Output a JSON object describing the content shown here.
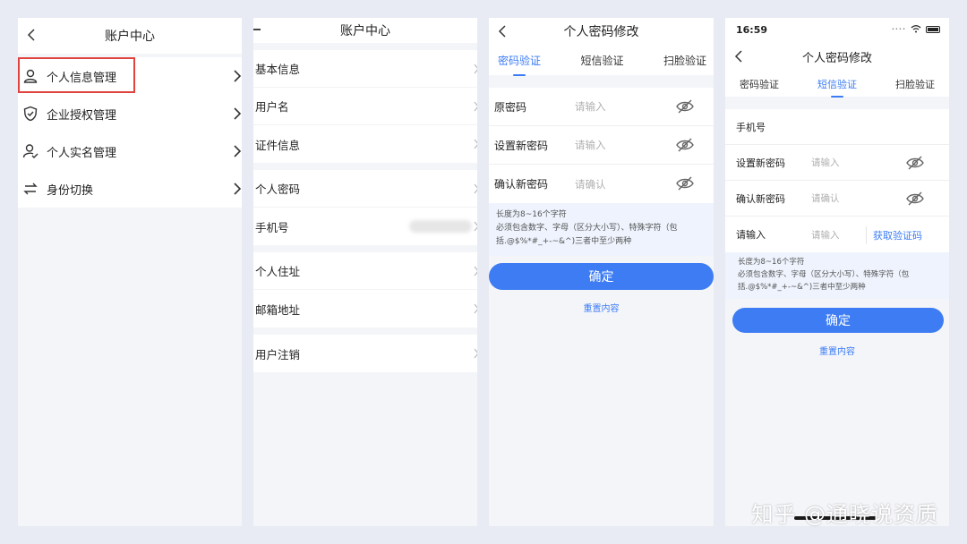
{
  "screen1": {
    "title": "账户中心",
    "items": [
      {
        "label": "个人信息管理",
        "icon": "person-icon"
      },
      {
        "label": "企业授权管理",
        "icon": "shield-icon"
      },
      {
        "label": "个人实名管理",
        "icon": "person-check-icon"
      },
      {
        "label": "身份切换",
        "icon": "switch-icon"
      }
    ]
  },
  "screen2": {
    "title": "账户中心",
    "groups": [
      [
        "基本信息",
        "用户名",
        "证件信息"
      ],
      [
        "个人密码",
        "手机号"
      ],
      [
        "个人住址",
        "邮箱地址"
      ],
      [
        "用户注销"
      ]
    ]
  },
  "screen3": {
    "title": "个人密码修改",
    "tabs": [
      "密码验证",
      "短信验证",
      "扫脸验证"
    ],
    "active_tab": 0,
    "fields": [
      {
        "label": "原密码",
        "placeholder": "请输入"
      },
      {
        "label": "设置新密码",
        "placeholder": "请输入"
      },
      {
        "label": "确认新密码",
        "placeholder": "请确认"
      }
    ],
    "hint_lines": [
      "长度为8~16个字符",
      "必须包含数字、字母（区分大小写）、特殊字符（包",
      "括.@$%*#_+-~&^)三者中至少两种"
    ],
    "confirm": "确定",
    "reset": "重置内容"
  },
  "screen4": {
    "time": "16:59",
    "title": "个人密码修改",
    "tabs": [
      "密码验证",
      "短信验证",
      "扫脸验证"
    ],
    "active_tab": 1,
    "phone_label": "手机号",
    "fields": [
      {
        "label": "设置新密码",
        "placeholder": "请输入"
      },
      {
        "label": "确认新密码",
        "placeholder": "请确认"
      }
    ],
    "code_field": {
      "label": "请输入",
      "placeholder": "请输入",
      "action": "获取验证码"
    },
    "hint_lines": [
      "长度为8~16个字符",
      "必须包含数字、字母（区分大小写）、特殊字符（包",
      "括.@$%*#_+-~&^)三者中至少两种"
    ],
    "confirm": "确定",
    "reset": "重置内容"
  },
  "watermark": "知乎 @通晓说资质",
  "colors": {
    "accent": "#3d7cf2",
    "highlight": "#e0433e",
    "background": "#e9ebf4"
  }
}
